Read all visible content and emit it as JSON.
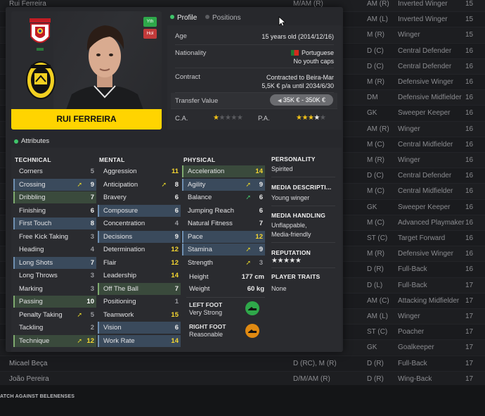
{
  "background_rows": [
    {
      "name": "Rui Ferreira",
      "pos": "M/AM (R)",
      "role_pos": "AM (R)",
      "role": "Inverted Winger",
      "age": "15"
    },
    {
      "name": "",
      "pos": "",
      "role_pos": "AM (L)",
      "role": "Inverted Winger",
      "age": "15"
    },
    {
      "name": "",
      "pos": "",
      "role_pos": "M (R)",
      "role": "Winger",
      "age": "15"
    },
    {
      "name": "",
      "pos": "",
      "role_pos": "D (C)",
      "role": "Central Defender",
      "age": "16"
    },
    {
      "name": "",
      "pos": "",
      "role_pos": "D (C)",
      "role": "Central Defender",
      "age": "16"
    },
    {
      "name": "",
      "pos": "",
      "role_pos": "M (R)",
      "role": "Defensive Winger",
      "age": "16"
    },
    {
      "name": "",
      "pos": "",
      "role_pos": "DM",
      "role": "Defensive Midfielder",
      "age": "16"
    },
    {
      "name": "",
      "pos": "",
      "role_pos": "GK",
      "role": "Sweeper Keeper",
      "age": "16"
    },
    {
      "name": "",
      "pos": "",
      "role_pos": "AM (R)",
      "role": "Winger",
      "age": "16"
    },
    {
      "name": "",
      "pos": "",
      "role_pos": "M (C)",
      "role": "Central Midfielder",
      "age": "16"
    },
    {
      "name": "",
      "pos": "",
      "role_pos": "M (R)",
      "role": "Winger",
      "age": "16"
    },
    {
      "name": "",
      "pos": "",
      "role_pos": "D (C)",
      "role": "Central Defender",
      "age": "16"
    },
    {
      "name": "",
      "pos": "",
      "role_pos": "M (C)",
      "role": "Central Midfielder",
      "age": "16"
    },
    {
      "name": "",
      "pos": "",
      "role_pos": "GK",
      "role": "Sweeper Keeper",
      "age": "16"
    },
    {
      "name": "",
      "pos": "",
      "role_pos": "M (C)",
      "role": "Advanced Playmaker",
      "age": "16"
    },
    {
      "name": "",
      "pos": "",
      "role_pos": "ST (C)",
      "role": "Target Forward",
      "age": "16"
    },
    {
      "name": "",
      "pos": "",
      "role_pos": "M (R)",
      "role": "Defensive Winger",
      "age": "16"
    },
    {
      "name": "",
      "pos": "",
      "role_pos": "D (R)",
      "role": "Full-Back",
      "age": "16"
    },
    {
      "name": "",
      "pos": "",
      "role_pos": "D (L)",
      "role": "Full-Back",
      "age": "17"
    },
    {
      "name": "",
      "pos": "",
      "role_pos": "AM (C)",
      "role": "Attacking Midfielder",
      "age": "17"
    },
    {
      "name": "",
      "pos": "",
      "role_pos": "AM (L)",
      "role": "Winger",
      "age": "17"
    },
    {
      "name": "",
      "pos": "",
      "role_pos": "ST (C)",
      "role": "Poacher",
      "age": "17"
    },
    {
      "name": "",
      "pos": "",
      "role_pos": "GK",
      "role": "Goalkeeper",
      "age": "17"
    },
    {
      "name": "Micael Beça",
      "pos": "D (RC), M (R)",
      "role_pos": "D (R)",
      "role": "Full-Back",
      "age": "17"
    },
    {
      "name": "João Pereira",
      "pos": "D/M/AM (R)",
      "role_pos": "D (R)",
      "role": "Wing-Back",
      "age": "17"
    }
  ],
  "footer_text": "ATCH AGAINST BELENENSES",
  "player": {
    "name": "RUI FERREIRA",
    "badge_youth": "Yth",
    "badge_hol": "Hol"
  },
  "tabs": {
    "profile": "Profile",
    "positions": "Positions"
  },
  "profile": {
    "age_label": "Age",
    "age_value": "15 years old (2014/12/16)",
    "nationality_label": "Nationality",
    "nationality_value": "Portuguese",
    "nationality_sub": "No youth caps",
    "contract_label": "Contract",
    "contract_value": "Contracted to Beira-Mar",
    "contract_sub": "5,5K € p/a until 2034/6/30",
    "transfer_label": "Transfer Value",
    "transfer_value": "35K € - 350K €",
    "ca_label": "C.A.",
    "ca_stars": 1,
    "pa_label": "P.A.",
    "pa_stars": 3.5
  },
  "attributes_title": "Attributes",
  "technical": {
    "title": "TECHNICAL",
    "items": [
      {
        "n": "Corners",
        "v": "5",
        "hl": "",
        "c": "g",
        "ar": ""
      },
      {
        "n": "Crossing",
        "v": "9",
        "hl": "b",
        "c": "w",
        "ar": "y"
      },
      {
        "n": "Dribbling",
        "v": "7",
        "hl": "g",
        "c": "w",
        "ar": ""
      },
      {
        "n": "Finishing",
        "v": "6",
        "hl": "",
        "c": "w",
        "ar": ""
      },
      {
        "n": "First Touch",
        "v": "8",
        "hl": "b",
        "c": "w",
        "ar": ""
      },
      {
        "n": "Free Kick Taking",
        "v": "3",
        "hl": "",
        "c": "g",
        "ar": ""
      },
      {
        "n": "Heading",
        "v": "4",
        "hl": "",
        "c": "g",
        "ar": ""
      },
      {
        "n": "Long Shots",
        "v": "7",
        "hl": "b",
        "c": "w",
        "ar": ""
      },
      {
        "n": "Long Throws",
        "v": "3",
        "hl": "",
        "c": "g",
        "ar": ""
      },
      {
        "n": "Marking",
        "v": "3",
        "hl": "",
        "c": "g",
        "ar": ""
      },
      {
        "n": "Passing",
        "v": "10",
        "hl": "g",
        "c": "b",
        "ar": ""
      },
      {
        "n": "Penalty Taking",
        "v": "5",
        "hl": "",
        "c": "g",
        "ar": "y"
      },
      {
        "n": "Tackling",
        "v": "2",
        "hl": "",
        "c": "g",
        "ar": ""
      },
      {
        "n": "Technique",
        "v": "12",
        "hl": "g",
        "c": "y",
        "ar": "y"
      }
    ]
  },
  "mental": {
    "title": "MENTAL",
    "items": [
      {
        "n": "Aggression",
        "v": "11",
        "hl": "",
        "c": "y",
        "ar": ""
      },
      {
        "n": "Anticipation",
        "v": "8",
        "hl": "",
        "c": "w",
        "ar": "y"
      },
      {
        "n": "Bravery",
        "v": "6",
        "hl": "",
        "c": "w",
        "ar": ""
      },
      {
        "n": "Composure",
        "v": "6",
        "hl": "b",
        "c": "w",
        "ar": ""
      },
      {
        "n": "Concentration",
        "v": "4",
        "hl": "",
        "c": "g",
        "ar": ""
      },
      {
        "n": "Decisions",
        "v": "9",
        "hl": "b",
        "c": "w",
        "ar": ""
      },
      {
        "n": "Determination",
        "v": "12",
        "hl": "",
        "c": "y",
        "ar": ""
      },
      {
        "n": "Flair",
        "v": "12",
        "hl": "",
        "c": "y",
        "ar": ""
      },
      {
        "n": "Leadership",
        "v": "14",
        "hl": "",
        "c": "y",
        "ar": ""
      },
      {
        "n": "Off The Ball",
        "v": "7",
        "hl": "g",
        "c": "w",
        "ar": ""
      },
      {
        "n": "Positioning",
        "v": "1",
        "hl": "",
        "c": "g",
        "ar": ""
      },
      {
        "n": "Teamwork",
        "v": "15",
        "hl": "",
        "c": "y",
        "ar": ""
      },
      {
        "n": "Vision",
        "v": "6",
        "hl": "b",
        "c": "w",
        "ar": ""
      },
      {
        "n": "Work Rate",
        "v": "14",
        "hl": "b",
        "c": "y",
        "ar": ""
      }
    ]
  },
  "physical": {
    "title": "PHYSICAL",
    "items": [
      {
        "n": "Acceleration",
        "v": "14",
        "hl": "g",
        "c": "y",
        "ar": ""
      },
      {
        "n": "Agility",
        "v": "9",
        "hl": "b",
        "c": "w",
        "ar": "y"
      },
      {
        "n": "Balance",
        "v": "6",
        "hl": "",
        "c": "w",
        "ar": "g"
      },
      {
        "n": "Jumping Reach",
        "v": "6",
        "hl": "",
        "c": "w",
        "ar": ""
      },
      {
        "n": "Natural Fitness",
        "v": "7",
        "hl": "",
        "c": "w",
        "ar": ""
      },
      {
        "n": "Pace",
        "v": "12",
        "hl": "b",
        "c": "y",
        "ar": ""
      },
      {
        "n": "Stamina",
        "v": "9",
        "hl": "b",
        "c": "w",
        "ar": "y"
      },
      {
        "n": "Strength",
        "v": "3",
        "hl": "",
        "c": "g",
        "ar": "y"
      }
    ],
    "height_label": "Height",
    "height_value": "177 cm",
    "weight_label": "Weight",
    "weight_value": "60 kg",
    "left_foot_label": "LEFT FOOT",
    "left_foot_value": "Very Strong",
    "right_foot_label": "RIGHT FOOT",
    "right_foot_value": "Reasonable",
    "left_foot_color": "#2fa84a",
    "right_foot_color": "#e08a12"
  },
  "side": {
    "personality_title": "PERSONALITY",
    "personality_value": "Spirited",
    "media_desc_title": "MEDIA DESCRIPTI...",
    "media_desc_value": "Young winger",
    "media_handling_title": "MEDIA HANDLING",
    "media_handling_value1": "Unflappable,",
    "media_handling_value2": "Media-friendly",
    "reputation_title": "REPUTATION",
    "reputation_stars": 5,
    "traits_title": "PLAYER TRAITS",
    "traits_value": "None"
  },
  "colors": {
    "accent_yellow": "#ffd400",
    "active_green": "#3fc46a"
  }
}
